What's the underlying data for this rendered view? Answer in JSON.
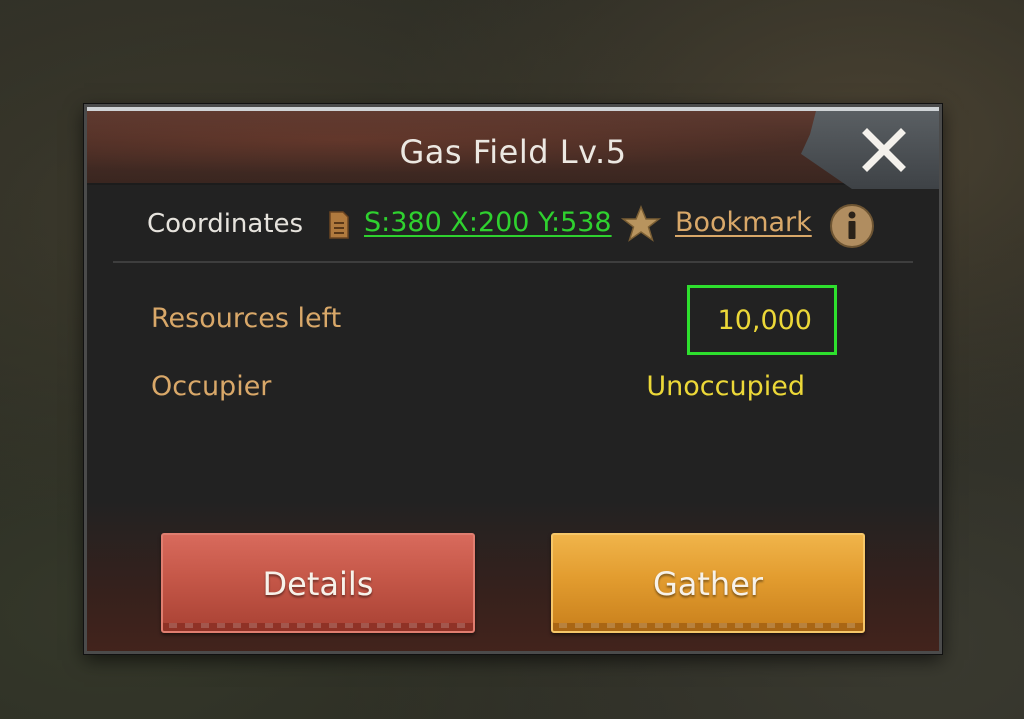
{
  "dialog": {
    "title": "Gas Field Lv.5",
    "close_icon": "close-icon"
  },
  "coordinates": {
    "label": "Coordinates",
    "value": "S:380 X:200 Y:538",
    "doc_icon": "document-icon",
    "star_icon": "star-icon",
    "bookmark_label": "Bookmark",
    "info_icon": "info-icon"
  },
  "fields": {
    "resources_left_label": "Resources left",
    "resources_left_value": "10,000",
    "occupier_label": "Occupier",
    "occupier_value": "Unoccupied"
  },
  "actions": {
    "details_label": "Details",
    "gather_label": "Gather"
  },
  "colors": {
    "coordinate_link": "#2fd12f",
    "bookmark_link": "#d9a869",
    "field_label": "#d9a869",
    "field_value": "#ecd838",
    "highlight_box": "#2ee02e",
    "details_button": "#c55748",
    "gather_button": "#e29c2f"
  }
}
